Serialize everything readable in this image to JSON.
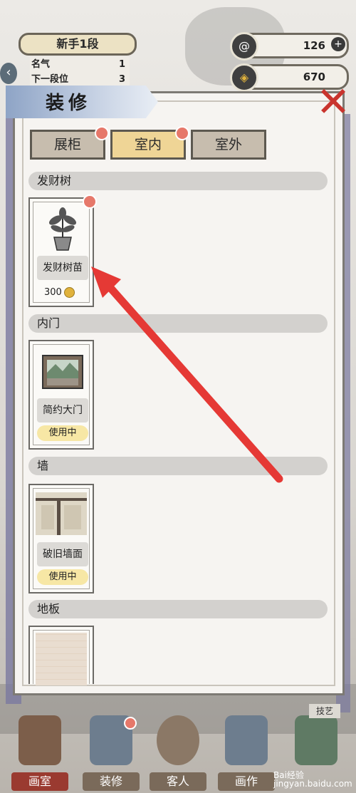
{
  "rank": {
    "title": "新手1段",
    "rows": [
      {
        "label": "名气",
        "value": "1"
      },
      {
        "label": "下一段位",
        "value": "3"
      }
    ]
  },
  "currencies": [
    {
      "name": "ink-currency",
      "icon": "swirl-icon",
      "value": "126"
    },
    {
      "name": "coin-currency",
      "icon": "coin-icon",
      "value": "670"
    }
  ],
  "panel": {
    "title": "装修"
  },
  "tabs": [
    {
      "label": "展柜",
      "active": false,
      "dot": true
    },
    {
      "label": "室内",
      "active": true,
      "dot": true
    },
    {
      "label": "室外",
      "active": false,
      "dot": false
    }
  ],
  "categories": [
    {
      "label": "发财树",
      "item": {
        "name": "发财树苗",
        "price": "300",
        "badge": ""
      }
    },
    {
      "label": "内门",
      "item": {
        "name": "简约大门",
        "price": "",
        "badge": "使用中"
      }
    },
    {
      "label": "墙",
      "item": {
        "name": "破旧墙面",
        "price": "",
        "badge": "使用中"
      }
    },
    {
      "label": "地板",
      "item": {
        "name": "",
        "price": "",
        "badge": ""
      }
    }
  ],
  "bottom_nav": [
    {
      "label": "画室"
    },
    {
      "label": "装修"
    },
    {
      "label": "客人"
    },
    {
      "label": "画作"
    },
    {
      "label": ""
    }
  ],
  "skill_tag": "技艺",
  "watermark": "Bai经验 jingyan.baidu.com",
  "colors": {
    "accent": "#e6786a",
    "tab_active": "#efd596",
    "close": "#c9342e"
  }
}
